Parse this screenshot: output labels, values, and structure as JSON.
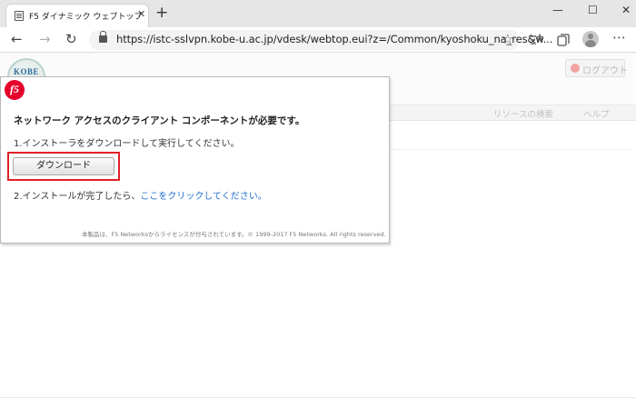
{
  "browser": {
    "tab_title": "F5 ダイナミック ウェブトップ",
    "tab_close": "✕",
    "new_tab": "+",
    "window_controls": {
      "minimize": "—",
      "maximize": "☐",
      "close": "✕"
    },
    "url": "https://istc-sslvpn.kobe-u.ac.jp/vdesk/webtop.eui?z=/Common/kyoshoku_na_res&w...",
    "nav": {
      "back": "←",
      "forward": "→",
      "refresh": "↻"
    },
    "star": "☆",
    "menu": "⋯"
  },
  "header": {
    "logo_text": "KOBE",
    "logout_label": "ログアウト",
    "resource_search": "リソースの検索",
    "help_label": "ヘルプ"
  },
  "dialog": {
    "logo_text": "f5",
    "title": "ネットワーク アクセスのクライアント コンポーネントが必要です。",
    "step1": "1.インストーラをダウンロードして実行してください。",
    "download_label": "ダウンロード",
    "step2_prefix": "2.インストールが完了したら、",
    "step2_link": "ここをクリックしてください。",
    "copyright": "本製品は、F5 Networksからライセンスが付与されています。© 1999-2017 F5 Networks. All rights reserved."
  },
  "colors": {
    "accent_red": "#e0202a",
    "link_blue": "#1e6fd0",
    "f5_red": "#e4002b"
  }
}
